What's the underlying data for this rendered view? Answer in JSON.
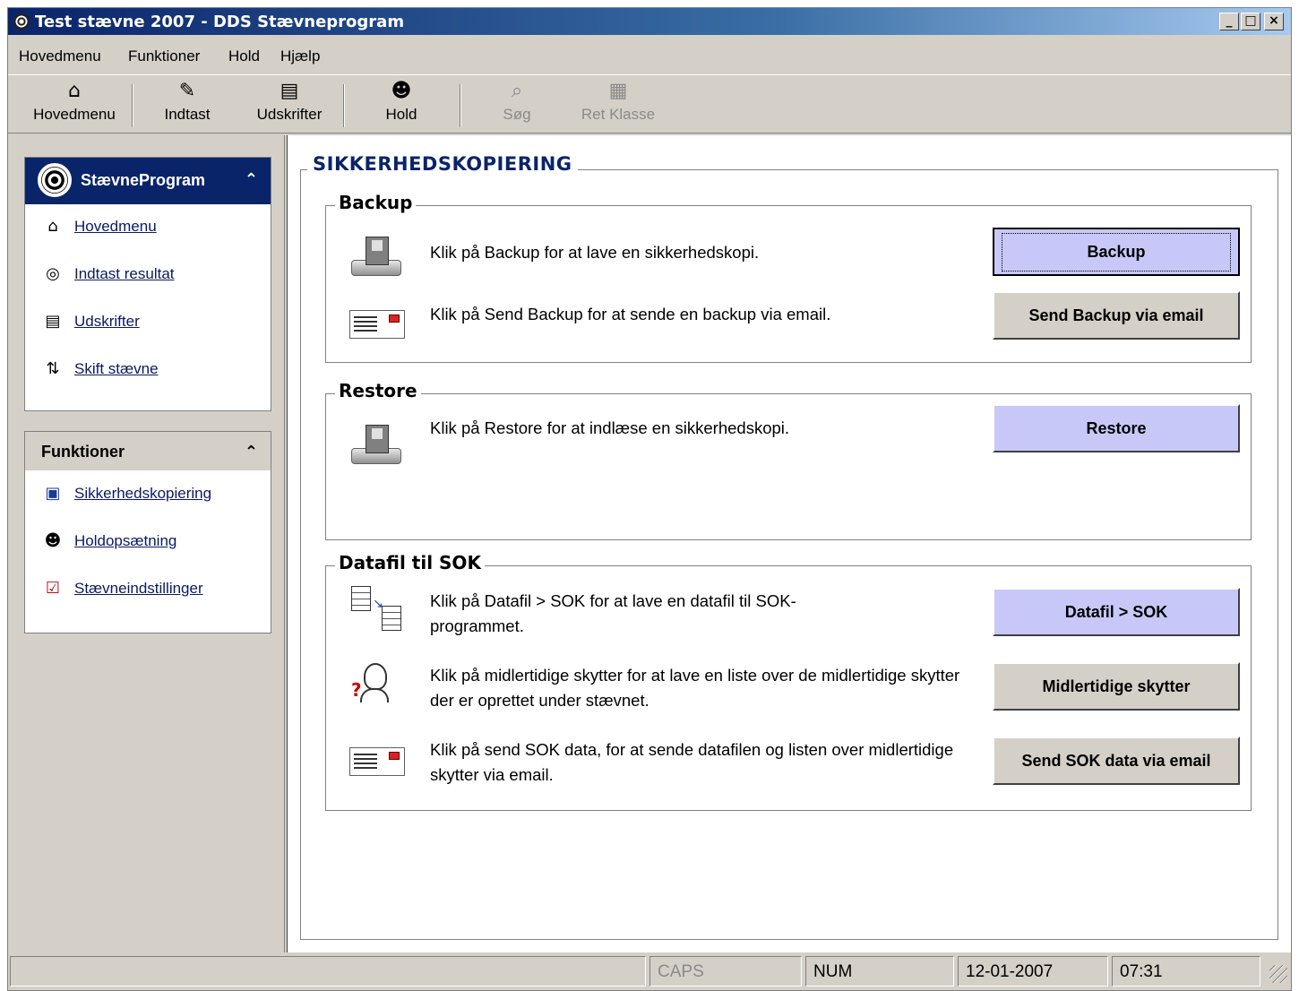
{
  "window": {
    "title": "Test stævne 2007 - DDS Stævneprogram",
    "controls": {
      "minimize": "_",
      "maximize": "□",
      "close": "×"
    }
  },
  "menu": [
    {
      "label": "Hovedmenu"
    },
    {
      "label": "Funktioner"
    },
    {
      "label": "Hold"
    },
    {
      "label": "Hjælp"
    }
  ],
  "toolbar": [
    {
      "label": "Hovedmenu",
      "icon": "house-icon",
      "enabled": true
    },
    {
      "label": "Indtast",
      "icon": "pencil-icon",
      "enabled": true
    },
    {
      "label": "Udskrifter",
      "icon": "printer-icon",
      "enabled": true
    },
    {
      "label": "Hold",
      "icon": "team-icon",
      "enabled": true
    },
    {
      "label": "Søg",
      "icon": "search-icon",
      "enabled": false
    },
    {
      "label": "Ret Klasse",
      "icon": "edit-class-icon",
      "enabled": false
    }
  ],
  "sidebar": {
    "group1": {
      "title": "StævneProgram",
      "collapse": "⌃",
      "items": [
        {
          "label": "Hovedmenu",
          "icon": "house-icon"
        },
        {
          "label": "Indtast resultat",
          "icon": "target-icon"
        },
        {
          "label": "Udskrifter",
          "icon": "printer-icon"
        },
        {
          "label": "Skift stævne",
          "icon": "switch-icon"
        }
      ]
    },
    "group2": {
      "title": "Funktioner",
      "collapse": "⌃",
      "items": [
        {
          "label": "Sikkerhedskopiering",
          "icon": "floppy-icon"
        },
        {
          "label": "Holdopsætning",
          "icon": "team-icon"
        },
        {
          "label": "Stævneindstillinger",
          "icon": "settings-check-icon"
        }
      ]
    }
  },
  "main": {
    "title": "SIKKERHEDSKOPIERING",
    "sections": {
      "backup": {
        "title": "Backup",
        "rows": [
          {
            "text": "Klik på Backup for at lave en sikkerhedskopi.",
            "button": "Backup"
          },
          {
            "text": "Klik på Send Backup for at sende en backup via email.",
            "button": "Send Backup via email"
          }
        ]
      },
      "restore": {
        "title": "Restore",
        "rows": [
          {
            "text": "Klik på Restore for at indlæse en sikkerhedskopi.",
            "button": "Restore"
          }
        ]
      },
      "datafil": {
        "title": "Datafil til SOK",
        "rows": [
          {
            "text": "Klik på Datafil > SOK for at lave en datafil til SOK-programmet.",
            "button": "Datafil > SOK"
          },
          {
            "text": "Klik på midlertidige skytter for at lave en liste over de midlertidige skytter der er oprettet under stævnet.",
            "button": "Midlertidige skytter"
          },
          {
            "text": "Klik på send SOK data, for at sende datafilen og listen over midlertidige skytter via email.",
            "button": "Send SOK data via email"
          }
        ]
      }
    }
  },
  "status": {
    "caps": "CAPS",
    "num": "NUM",
    "date": "12-01-2007",
    "time": "07:31"
  },
  "colors": {
    "title_gradient_start": "#0a246a",
    "title_gradient_end": "#a6caf0",
    "header_text": "#0a246a",
    "primary_button": "#c8c8f8",
    "chrome": "#d4d0c8"
  }
}
